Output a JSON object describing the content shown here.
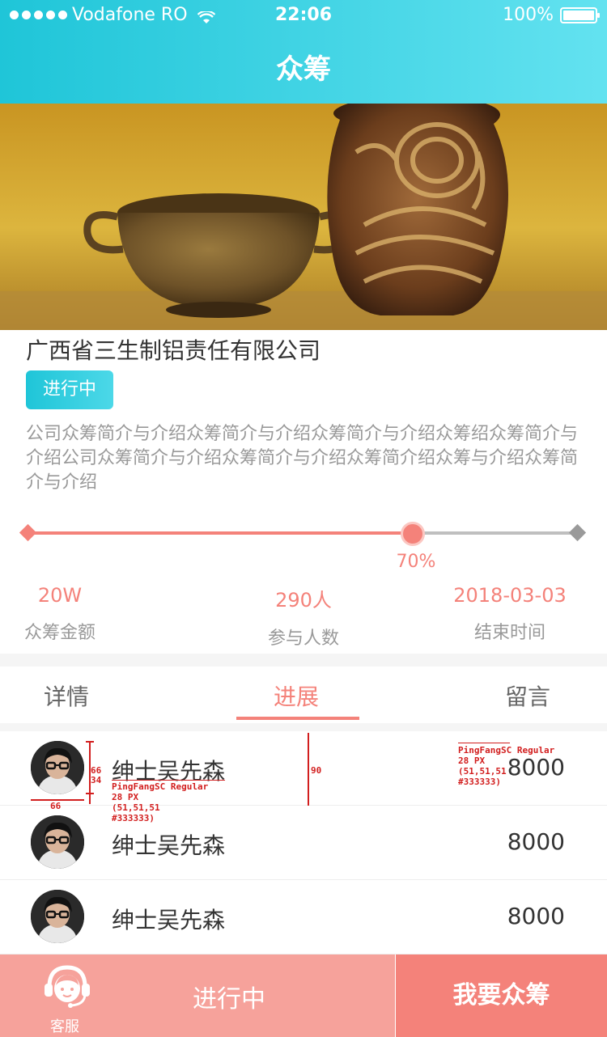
{
  "status_bar": {
    "carrier": "Vodafone RO",
    "time": "22:06",
    "battery": "100%"
  },
  "nav": {
    "title": "众筹"
  },
  "project": {
    "company": "广西省三生制铝责任有限公司",
    "status": "进行中",
    "description": "公司众筹简介与介绍众筹简介与介绍众筹简介与介绍众筹绍众筹简介与介绍公司众筹简介与介绍众筹简介与介绍众筹简介绍众筹与介绍众筹简介与介绍"
  },
  "progress": {
    "percent": 70,
    "label": "70%"
  },
  "stats": [
    {
      "value": "20W",
      "label": "众筹金额"
    },
    {
      "value": "290人",
      "label": "参与人数"
    },
    {
      "value": "2018-03-03",
      "label": "结束时间"
    }
  ],
  "tabs": [
    {
      "label": "详情",
      "active": false
    },
    {
      "label": "进展",
      "active": true
    },
    {
      "label": "留言",
      "active": false
    }
  ],
  "backers": [
    {
      "name": "绅士吴先森",
      "amount": "8000"
    },
    {
      "name": "绅士吴先森",
      "amount": "8000"
    },
    {
      "name": "绅士吴先森",
      "amount": "8000"
    }
  ],
  "annotations": {
    "name_spec": "PingFangSC Regular\n28 PX\n(51,51,51\n#333333)",
    "amount_spec": "PingFangSC Regular\n28 PX\n(51,51,51\n#333333)",
    "avatar_h": "66",
    "avatar_gap": "34",
    "avatar_w": "66",
    "row_h": "90"
  },
  "bottom_bar": {
    "service_label": "客服",
    "status_label": "进行中",
    "action_label": "我要众筹"
  },
  "colors": {
    "accent": "#f4827a",
    "header_gradient_start": "#1fc5d8",
    "header_gradient_end": "#63e2f0",
    "text": "#333333",
    "muted": "#999999"
  }
}
